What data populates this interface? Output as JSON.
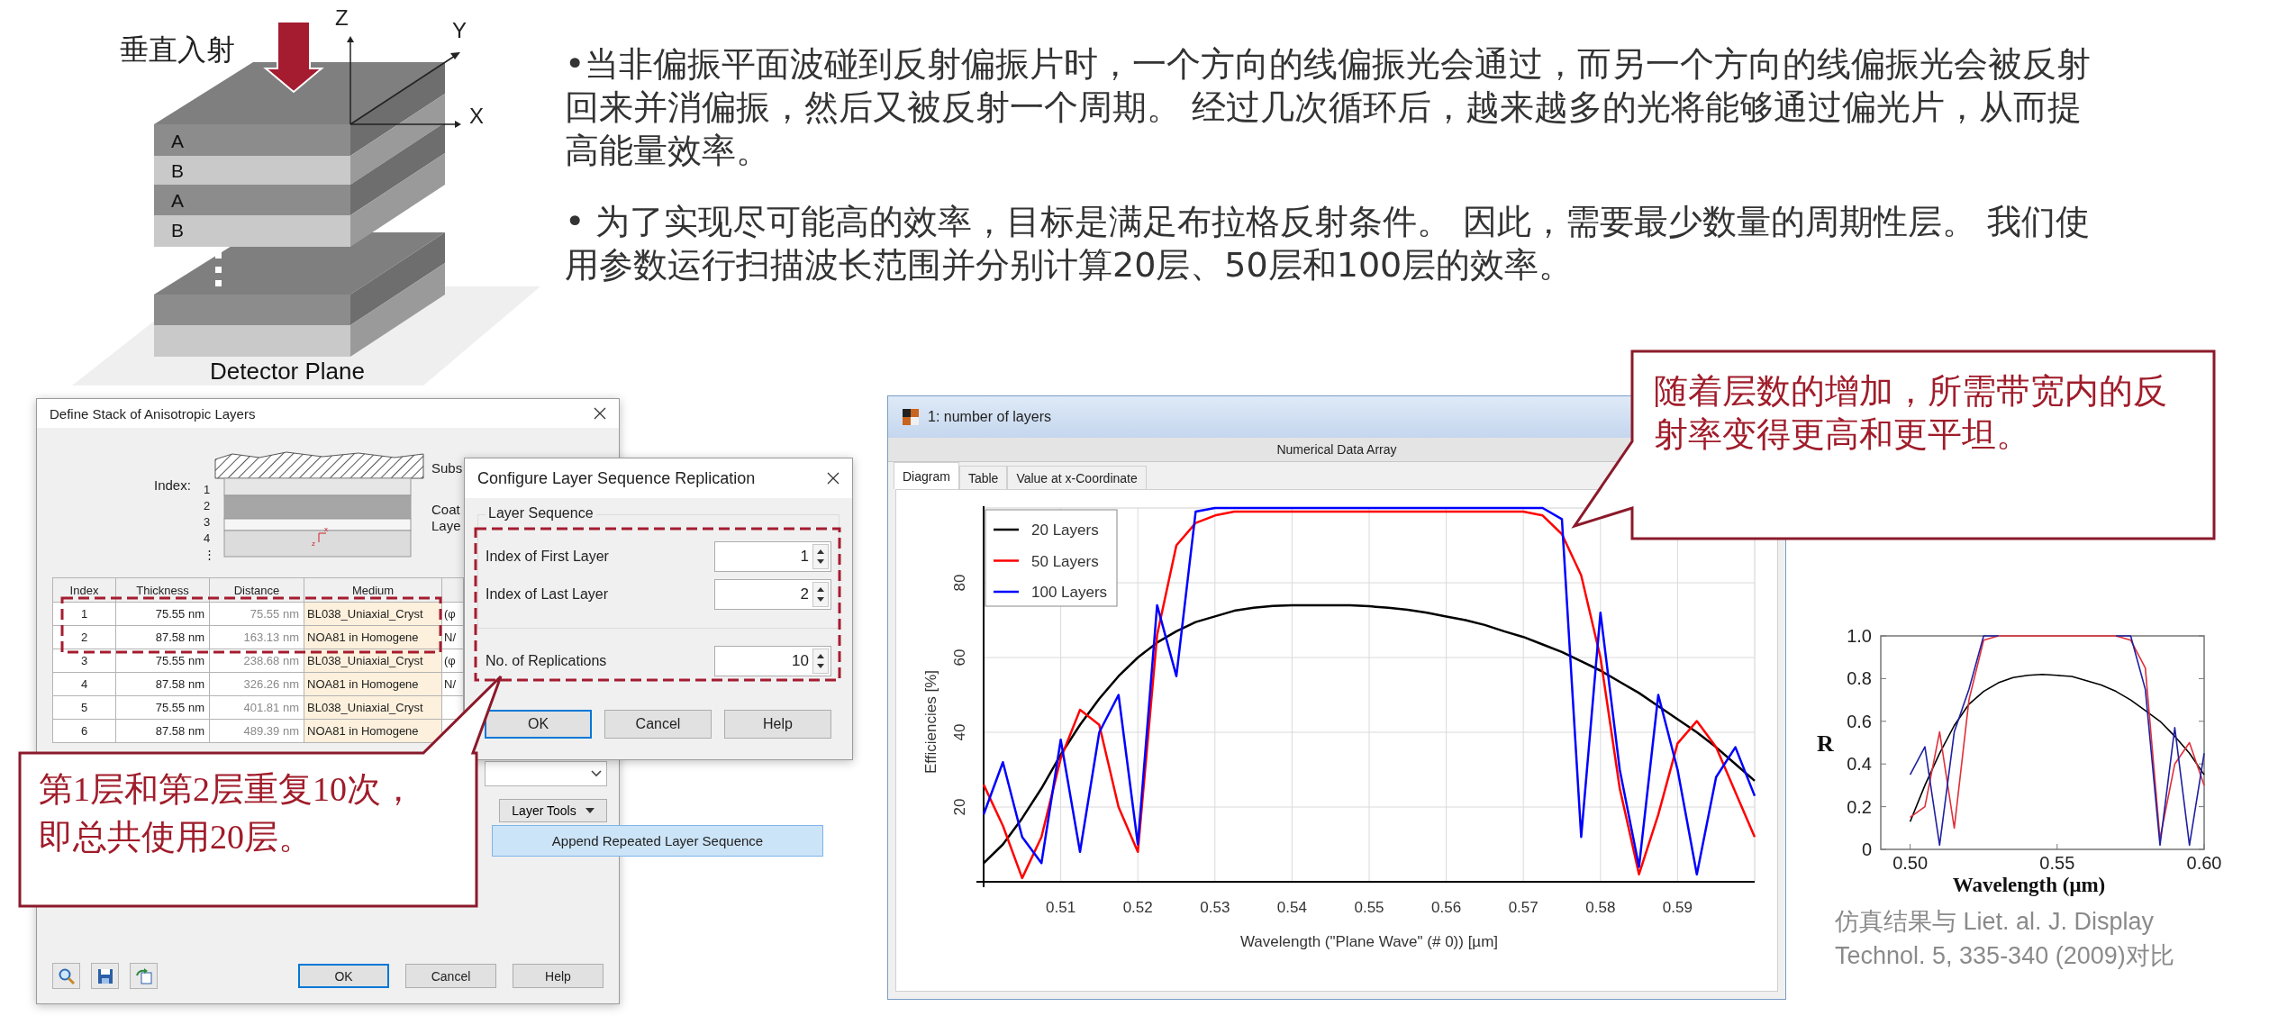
{
  "incidence_diagram": {
    "incidence_label": "垂直入射",
    "axis_labels": [
      "Z",
      "Y",
      "X"
    ],
    "layer_labels": [
      "A",
      "B",
      "A",
      "B"
    ],
    "plane_label": "Detector Plane"
  },
  "bullets": [
    "•当非偏振平面波碰到反射偏振片时，一个方向的线偏振光会通过，而另一个方向的线偏振光会被反射回来并消偏振，然后又被反射一个周期。 经过几次循环后，越来越多的光将能够通过偏光片，从而提高能量效率。",
    "• 为了实现尽可能高的效率，目标是满足布拉格反射条件。 因此，需要最少数量的周期性层。 我们使用参数运行扫描波长范围并分别计算20层、50层和100层的效率。"
  ],
  "stack_dialog": {
    "title": "Define Stack of Anisotropic Layers",
    "index_label": "Index:",
    "indices": [
      "1",
      "2",
      "3",
      "4",
      "⋮"
    ],
    "mini_axis_labels": [
      "x",
      "z"
    ],
    "side_labels": [
      "Subs",
      "Coat",
      "Laye"
    ],
    "table": {
      "columns": [
        "Index",
        "Thickness",
        "Distance",
        "Medium"
      ],
      "rows": [
        [
          "1",
          "75.55 nm",
          "75.55 nm",
          "BL038_Uniaxial_Cryst",
          "(φ"
        ],
        [
          "2",
          "87.58 nm",
          "163.13 nm",
          "NOA81 in Homogene",
          "N/"
        ],
        [
          "3",
          "75.55 nm",
          "238.68 nm",
          "BL038_Uniaxial_Cryst",
          "(φ"
        ],
        [
          "4",
          "87.58 nm",
          "326.26 nm",
          "NOA81 in Homogene",
          "N/"
        ],
        [
          "5",
          "75.55 nm",
          "401.81 nm",
          "BL038_Uniaxial_Cryst"
        ],
        [
          "6",
          "87.58 nm",
          "489.39 nm",
          "NOA81 in Homogene"
        ]
      ]
    },
    "layer_tools": "Layer Tools",
    "menu_item": "Append Repeated Layer Sequence",
    "buttons": [
      {
        "label": "OK",
        "default": true
      },
      {
        "label": "Cancel",
        "default": false
      },
      {
        "label": "Help",
        "default": false
      }
    ]
  },
  "replication_dialog": {
    "title": "Configure Layer Sequence Replication",
    "group_label": "Layer Sequence",
    "fields": [
      {
        "label": "Index of First Layer",
        "value": "1"
      },
      {
        "label": "Index of Last Layer",
        "value": "2"
      },
      {
        "label": "No. of Replications",
        "value": "10"
      }
    ],
    "buttons": [
      {
        "label": "OK",
        "default": true
      },
      {
        "label": "Cancel",
        "default": false
      },
      {
        "label": "Help",
        "default": false
      }
    ]
  },
  "callouts": [
    {
      "text": "第1层和第2层重复10次，即总共使用20层。"
    },
    {
      "text": "随着层数的增加，所需带宽内的反射率变得更高和更平坦。"
    }
  ],
  "chart_window": {
    "title": "1: number of layers",
    "header": "Numerical Data Array",
    "tabs": [
      {
        "label": "Diagram",
        "selected": true
      },
      {
        "label": "Table",
        "selected": false
      },
      {
        "label": "Value at x-Coordinate",
        "selected": false
      }
    ],
    "chart_data": {
      "type": "line",
      "grid": true,
      "legend": true,
      "xlabel": "Wavelength (\"Plane Wave\" (# 0)) [µm]",
      "ylabel": "Efficiencies  [%]",
      "xlim": [
        0.5,
        0.6
      ],
      "ylim": [
        0,
        100
      ],
      "xticks": [
        0.51,
        0.52,
        0.53,
        0.54,
        0.55,
        0.56,
        0.57,
        0.58,
        0.59
      ],
      "yticks": [
        20,
        40,
        60,
        80
      ],
      "x": [
        0.5,
        0.5025,
        0.505,
        0.5075,
        0.51,
        0.5125,
        0.515,
        0.5175,
        0.52,
        0.5225,
        0.525,
        0.5275,
        0.53,
        0.5325,
        0.535,
        0.5375,
        0.54,
        0.5425,
        0.545,
        0.5475,
        0.55,
        0.5525,
        0.555,
        0.5575,
        0.56,
        0.5625,
        0.565,
        0.5675,
        0.57,
        0.5725,
        0.575,
        0.5775,
        0.58,
        0.5825,
        0.585,
        0.5875,
        0.59,
        0.5925,
        0.595,
        0.5975,
        0.6
      ],
      "series": [
        {
          "name": "20 Layers",
          "color": "#000000",
          "values": [
            5,
            10,
            17,
            25,
            34,
            42,
            49,
            55,
            60,
            64,
            67,
            69.5,
            71,
            72.5,
            73.3,
            73.8,
            74,
            74,
            74,
            74,
            73.7,
            73.3,
            72.8,
            72,
            71,
            70,
            68.7,
            67,
            65.5,
            63.5,
            61.5,
            59,
            56.5,
            53.5,
            50.5,
            47,
            43.5,
            40,
            36,
            31.5,
            27
          ]
        },
        {
          "name": "50 Layers",
          "color": "#ff0000",
          "values": [
            26,
            15,
            1,
            12,
            33,
            46,
            42,
            20,
            8,
            66,
            90,
            96,
            98,
            99,
            99,
            99,
            99,
            99,
            99,
            99,
            99,
            99,
            99,
            99,
            99,
            99,
            99,
            99,
            99,
            98,
            93,
            82,
            60,
            25,
            2,
            18,
            37,
            43,
            36,
            24,
            12
          ]
        },
        {
          "name": "100 Layers",
          "color": "#0000ff",
          "values": [
            18,
            32,
            12,
            5,
            38,
            8,
            40,
            50,
            10,
            74,
            55,
            99,
            100,
            100,
            100,
            100,
            100,
            100,
            100,
            100,
            100,
            100,
            100,
            100,
            100,
            100,
            100,
            100,
            100,
            100,
            97,
            12,
            72,
            30,
            4,
            50,
            30,
            2,
            28,
            36,
            23
          ]
        }
      ]
    }
  },
  "reference_chart": {
    "chart_data": {
      "type": "line",
      "xlabel": "Wavelength (μm)",
      "ylabel": "R",
      "xlim": [
        0.49,
        0.6
      ],
      "ylim": [
        0,
        1
      ],
      "xticks": [
        {
          "value": 0.5,
          "label": "0.50"
        },
        {
          "value": 0.55,
          "label": "0.55"
        },
        {
          "value": 0.6,
          "label": "0.60"
        }
      ],
      "yticks": [
        0,
        0.2,
        0.4,
        0.6,
        0.8,
        {
          "value": 1,
          "label": "1.0"
        }
      ],
      "x": [
        0.5,
        0.505,
        0.51,
        0.515,
        0.52,
        0.525,
        0.53,
        0.535,
        0.54,
        0.545,
        0.55,
        0.555,
        0.56,
        0.565,
        0.57,
        0.575,
        0.58,
        0.585,
        0.59,
        0.595,
        0.6
      ],
      "series": [
        {
          "color": "#000000",
          "values": [
            0.13,
            0.3,
            0.45,
            0.58,
            0.68,
            0.74,
            0.78,
            0.805,
            0.815,
            0.82,
            0.815,
            0.81,
            0.79,
            0.77,
            0.74,
            0.7,
            0.65,
            0.6,
            0.53,
            0.45,
            0.35
          ]
        },
        {
          "color": "#e0303a",
          "values": [
            0.15,
            0.2,
            0.55,
            0.1,
            0.7,
            0.98,
            1,
            1,
            1,
            1,
            1,
            1,
            1,
            1,
            1,
            0.98,
            0.85,
            0.05,
            0.4,
            0.5,
            0.3
          ]
        },
        {
          "color": "#2020a0",
          "values": [
            0.35,
            0.48,
            0.02,
            0.55,
            0.75,
            1,
            1,
            null,
            null,
            null,
            null,
            null,
            null,
            null,
            1,
            1,
            0.75,
            0.02,
            0.57,
            0.02,
            0.45
          ]
        }
      ]
    },
    "caption": "仿真结果与 Liet. al. J. Display Technol. 5, 335-340 (2009)对比"
  }
}
